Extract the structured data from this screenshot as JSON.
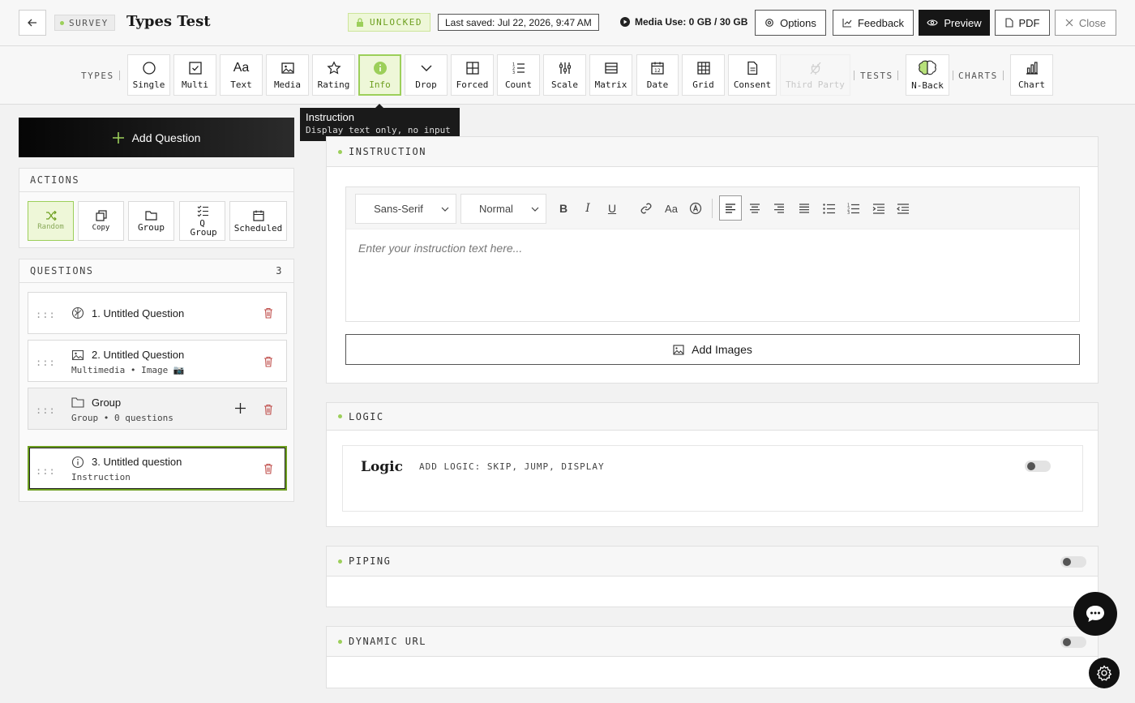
{
  "header": {
    "survey_tag": "SURVEY",
    "title": "Types Test",
    "unlocked": "UNLOCKED",
    "last_saved": "Last saved: Jul 22, 2026, 9:47 AM",
    "media_use": "Media Use: 0 GB / 30 GB",
    "buttons": {
      "options": "Options",
      "feedback": "Feedback",
      "preview": "Preview",
      "pdf": "PDF",
      "close": "Close"
    }
  },
  "toolbar": {
    "types_label": "TYPES",
    "tests_label": "TESTS",
    "charts_label": "CHARTS",
    "types": [
      {
        "label": "Single",
        "icon": "circle-icon"
      },
      {
        "label": "Multi",
        "icon": "checkbox-icon"
      },
      {
        "label": "Text",
        "icon": "text-aa-icon"
      },
      {
        "label": "Media",
        "icon": "image-icon"
      },
      {
        "label": "Rating",
        "icon": "star-icon"
      },
      {
        "label": "Info",
        "icon": "info-icon",
        "active": true
      },
      {
        "label": "Drop",
        "icon": "chevron-down-icon"
      },
      {
        "label": "Forced",
        "icon": "grid-icon"
      },
      {
        "label": "Count",
        "icon": "numbered-list-icon"
      },
      {
        "label": "Scale",
        "icon": "sliders-icon"
      },
      {
        "label": "Matrix",
        "icon": "matrix-icon"
      },
      {
        "label": "Date",
        "icon": "calendar-icon"
      },
      {
        "label": "Grid",
        "icon": "table-icon"
      },
      {
        "label": "Consent",
        "icon": "document-icon"
      },
      {
        "label": "Third Party",
        "icon": "plug-icon",
        "disabled": true
      }
    ],
    "tests": [
      {
        "label": "N-Back",
        "icon": "brain-icon"
      }
    ],
    "charts": [
      {
        "label": "Chart",
        "icon": "bar-chart-icon"
      }
    ]
  },
  "tooltip": {
    "title": "Instruction",
    "subtitle": "Display text only, no input"
  },
  "left": {
    "add_question": "Add Question",
    "actions_label": "ACTIONS",
    "actions": [
      {
        "label": "Random"
      },
      {
        "label": "Copy"
      },
      {
        "label": "Group"
      },
      {
        "label": "Q Group"
      },
      {
        "label": "Scheduled"
      }
    ],
    "questions_label": "QUESTIONS",
    "questions_count": "3",
    "questions": [
      {
        "title": "1. Untitled Question",
        "subtitle": ""
      },
      {
        "title": "2. Untitled Question",
        "subtitle": "Multimedia • Image 📷"
      },
      {
        "title": "Group",
        "subtitle": "Group • 0 questions"
      },
      {
        "title": "3. Untitled question",
        "subtitle": "Instruction"
      }
    ]
  },
  "main": {
    "instruction_label": "INSTRUCTION",
    "font_select": "Sans-Serif",
    "size_select": "Normal",
    "placeholder": "Enter your instruction text here...",
    "add_images": "Add Images",
    "logic_label": "LOGIC",
    "logic_title": "Logic",
    "logic_sub": "ADD LOGIC: SKIP, JUMP, DISPLAY",
    "piping_label": "PIPING",
    "dynamic_url_label": "DYNAMIC URL"
  },
  "colors": {
    "accent": "#9ccf5a",
    "accent_dark": "#6d9f1f",
    "danger": "#c0504d",
    "dark": "#161616"
  }
}
